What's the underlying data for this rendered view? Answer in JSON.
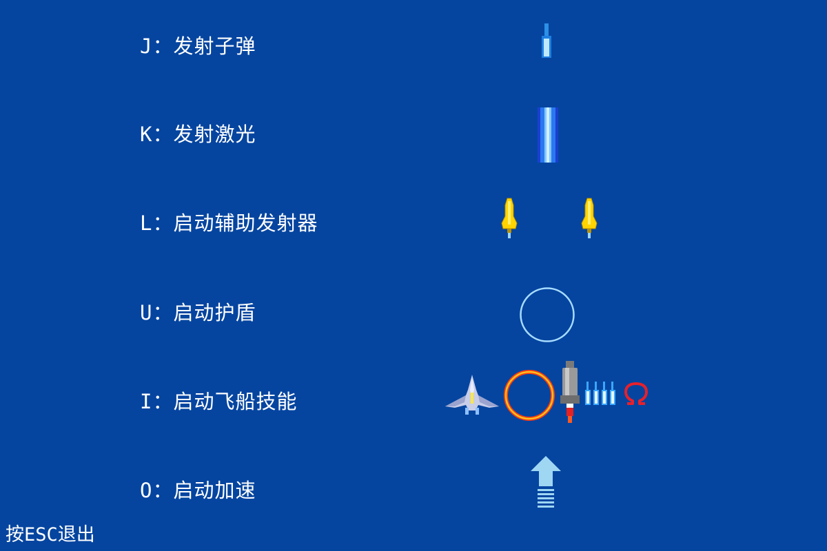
{
  "controls": [
    {
      "key": "J",
      "label": "J：发射子弹",
      "icon": "bullet-icon"
    },
    {
      "key": "K",
      "label": "K：发射激光",
      "icon": "laser-icon"
    },
    {
      "key": "L",
      "label": "L：启动辅助发射器",
      "icon": "auxiliary-launcher-icon"
    },
    {
      "key": "U",
      "label": "U：启动护盾",
      "icon": "shield-icon"
    },
    {
      "key": "I",
      "label": "I：启动飞船技能",
      "icon": "ship-skill-icon"
    },
    {
      "key": "O",
      "label": "O：启动加速",
      "icon": "boost-arrow-icon"
    }
  ],
  "exit_hint": "按ESC退出",
  "colors": {
    "background": "#0545a0",
    "text": "#ffffff",
    "bullet": "#3aa8ff",
    "laser": "#1e6cf0",
    "launcher": "#ffd400",
    "shield_ring": "#9fd6ff",
    "fire_ring": "#ff4a10",
    "omega": "#e8202a",
    "boost_arrow": "#9fd6f2"
  }
}
